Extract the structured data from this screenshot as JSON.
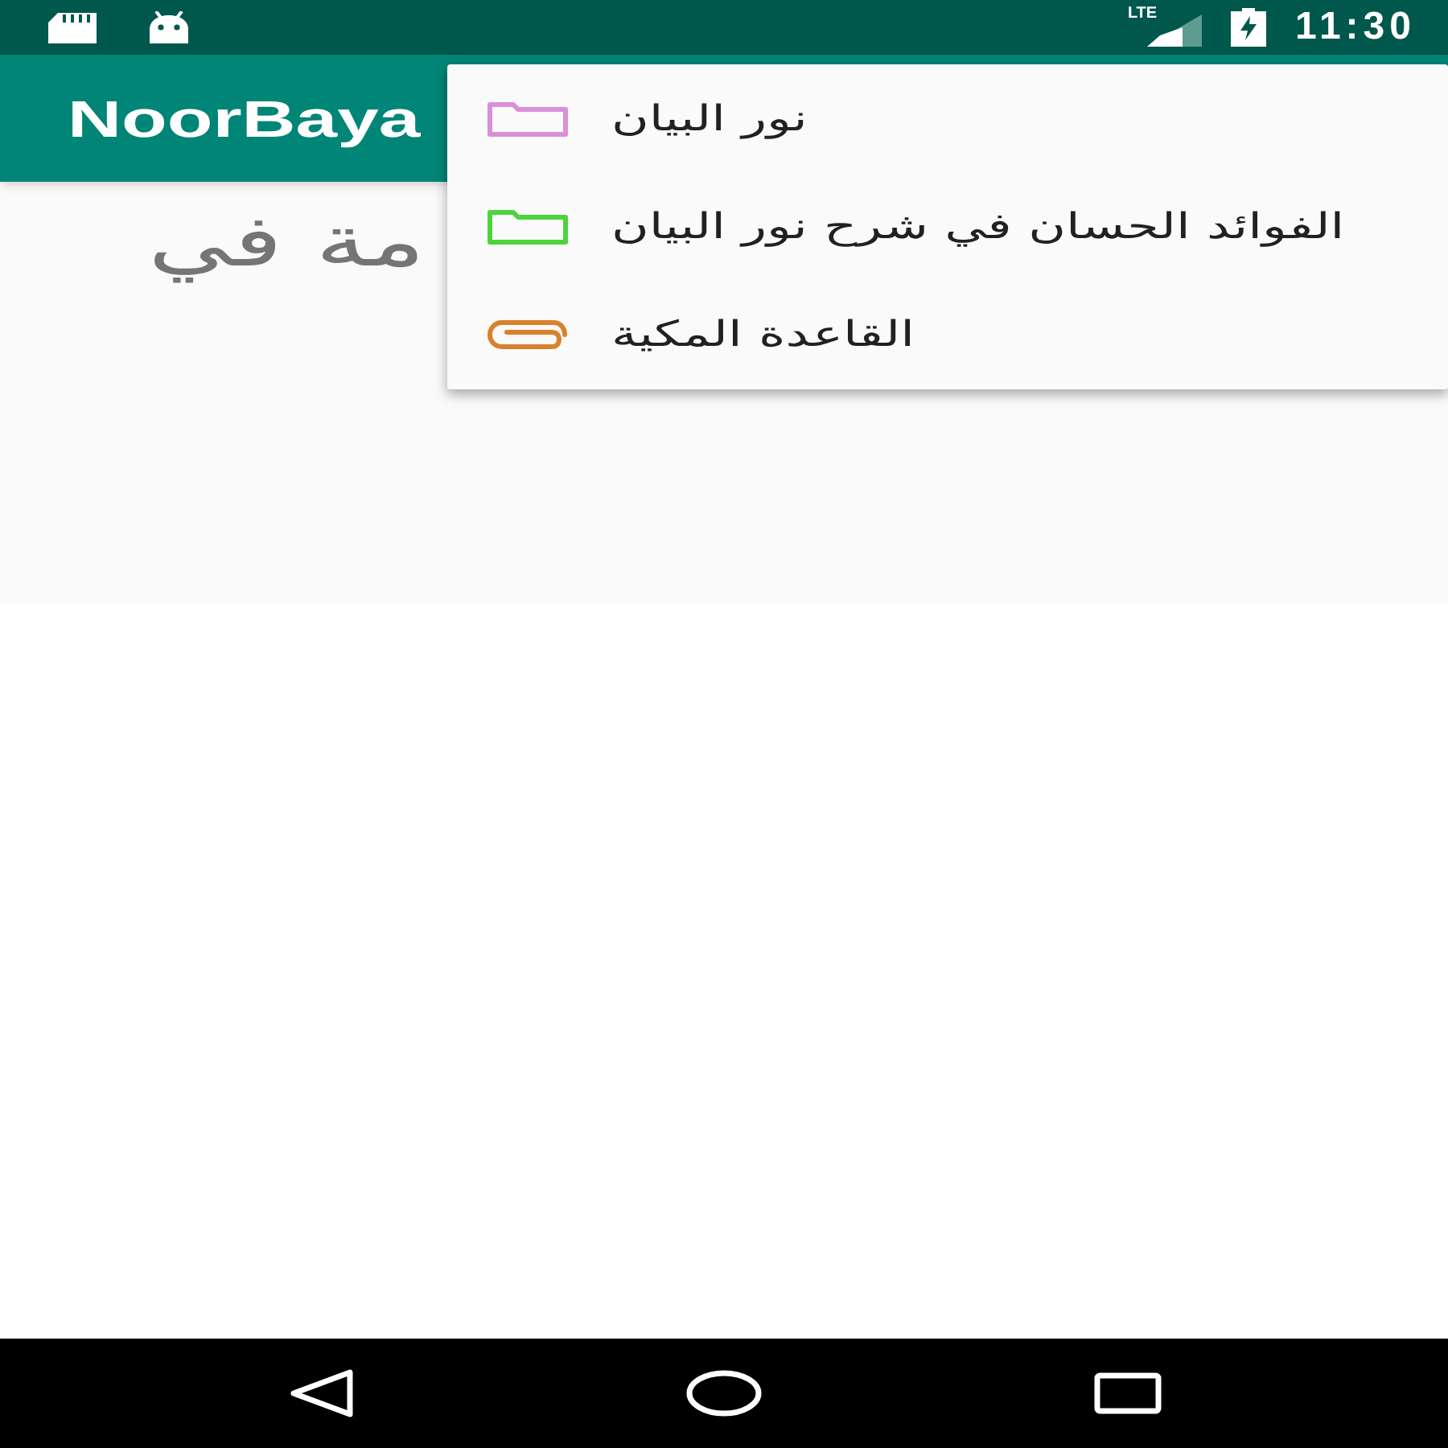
{
  "status_bar": {
    "network_type": "LTE",
    "time": "11:30"
  },
  "app_bar": {
    "title": "NoorBaya"
  },
  "content": {
    "text": "مة في"
  },
  "menu": {
    "items": [
      {
        "kind": "folder",
        "color": "#d98fd9",
        "label": "نور البيان"
      },
      {
        "kind": "folder",
        "color": "#4cd43c",
        "label": "الفوائد الحسان في شرح نور البيان"
      },
      {
        "kind": "clip",
        "color": "#d9822b",
        "label": "القاعدة المكية"
      }
    ]
  }
}
